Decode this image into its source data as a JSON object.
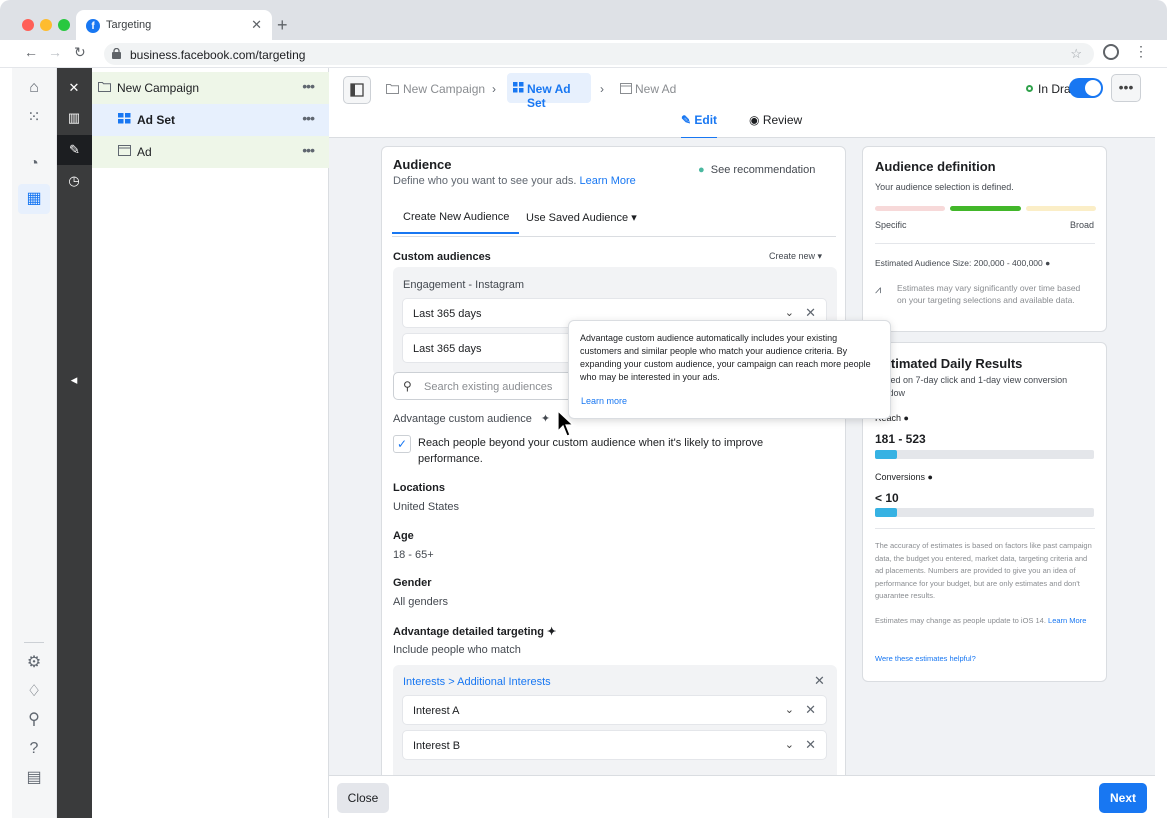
{
  "browser": {
    "tab_title": "Targeting",
    "url": "business.facebook.com/targeting"
  },
  "tree": {
    "items": [
      {
        "label": "New Campaign"
      },
      {
        "label": "Ad Set"
      },
      {
        "label": "Ad"
      }
    ]
  },
  "topbar": {
    "crumbs": [
      "New Campaign",
      "New Ad Set",
      "New Ad"
    ],
    "status": "In Draft",
    "tabs": [
      "Edit",
      "Review"
    ]
  },
  "audience": {
    "title": "Audience",
    "subtitle": "Define who you want to see your ads.",
    "learn_more": "Learn More",
    "recommendation": "See recommendation",
    "tabs": [
      "Create New Audience",
      "Use Saved Audience"
    ],
    "custom_audiences_label": "Custom audiences",
    "create_new": "Create new",
    "engagement_label": "Engagement - Instagram",
    "range_1": "Last 365 days",
    "range_2": "Last 365 days",
    "search_placeholder": "Search existing audiences",
    "advantage_label": "Advantage custom audience",
    "advantage_checkbox": "Reach people beyond your custom audience when it's likely to improve performance.",
    "locations_label": "Locations",
    "locations_value": "United States",
    "age_label": "Age",
    "age_value": "18 - 65+",
    "gender_label": "Gender",
    "gender_value": "All genders",
    "detailed_label": "Advantage detailed targeting",
    "include_label": "Include people who match",
    "interests_path": "Interests > Additional Interests",
    "interests": [
      "Interest A",
      "Interest B"
    ]
  },
  "tooltip": {
    "text": "Advantage custom audience automatically includes your existing customers and similar people who match your audience criteria. By expanding your custom audience, your campaign can reach more people who may be interested in your ads.",
    "learn_more": "Learn more"
  },
  "definition": {
    "title": "Audience definition",
    "status": "Your audience selection is defined.",
    "specific": "Specific",
    "broad": "Broad",
    "size": "Estimated Audience Size: 200,000 - 400,000",
    "note": "Estimates may vary significantly over time based on your targeting selections and available data."
  },
  "daily": {
    "title": "Estimated Daily Results",
    "subtitle": "Based on 7-day click and 1-day view conversion window",
    "reach_label": "Reach",
    "reach_value": "181 - 523",
    "reach_fill": 0.1,
    "conversions_label": "Conversions",
    "conversions_value": "< 10",
    "conversions_fill": 0.1,
    "disclaimer": "The accuracy of estimates is based on factors like past campaign data, the budget you entered, market data, targeting criteria and ad placements. Numbers are provided to give you an idea of performance for your budget, but are only estimates and don't guarantee results.",
    "ios_note": "Estimates may change as people update to iOS 14.",
    "ios_learn": "Learn More",
    "helpful": "Were these estimates helpful?"
  },
  "footer": {
    "close": "Close",
    "next": "Next"
  },
  "colors": {
    "accent": "#1877f2",
    "green": "#31a24c",
    "meter_green": "#42b72a",
    "bar_blue": "#36b2e3"
  }
}
